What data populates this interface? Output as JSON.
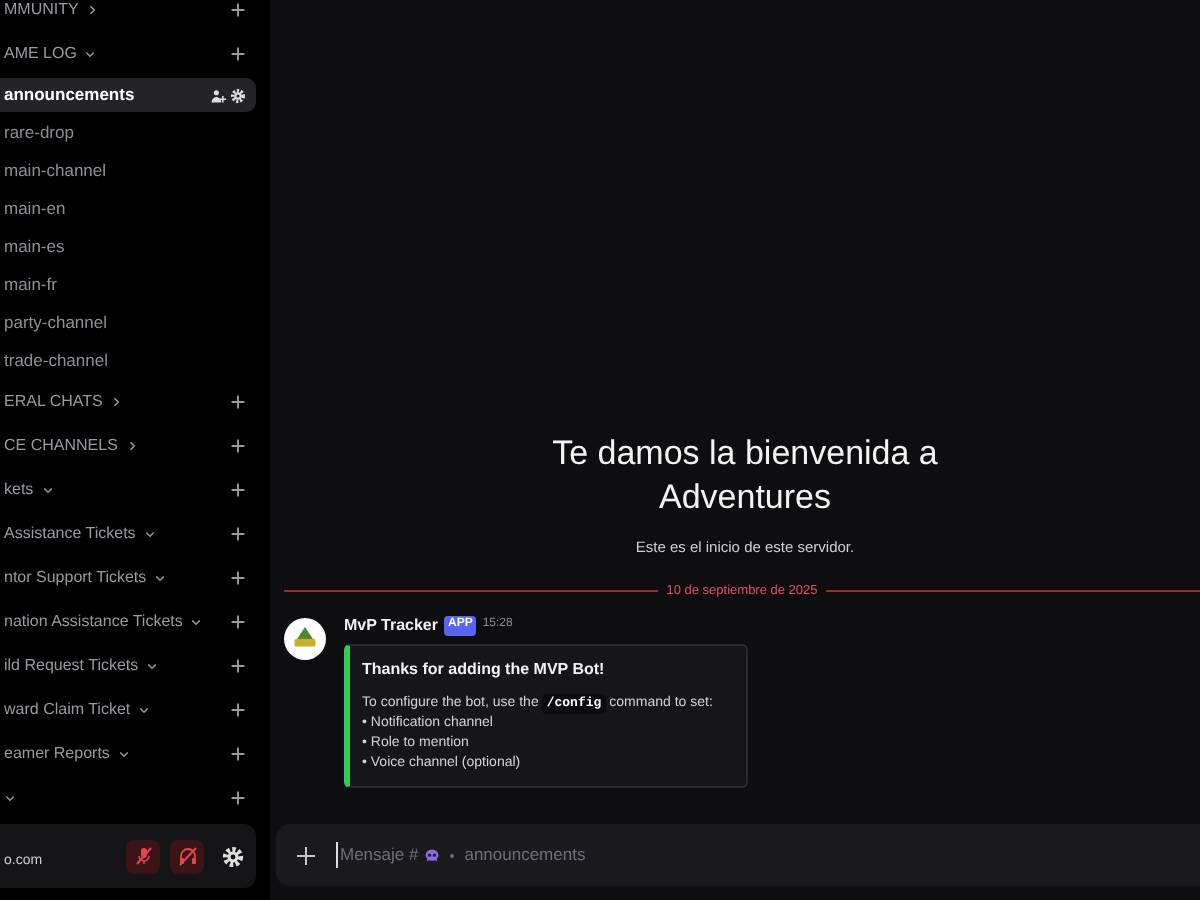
{
  "sidebar": {
    "sections": [
      {
        "kind": "category",
        "label": "MMUNITY",
        "expanded": false
      },
      {
        "kind": "category",
        "label": "AME LOG",
        "expanded": true
      },
      {
        "kind": "channel",
        "label": "announcements",
        "selected": true
      },
      {
        "kind": "channel",
        "label": "rare-drop",
        "selected": false
      },
      {
        "kind": "channel",
        "label": "main-channel",
        "selected": false
      },
      {
        "kind": "channel",
        "label": "main-en",
        "selected": false
      },
      {
        "kind": "channel",
        "label": "main-es",
        "selected": false
      },
      {
        "kind": "channel",
        "label": "main-fr",
        "selected": false
      },
      {
        "kind": "channel",
        "label": "party-channel",
        "selected": false
      },
      {
        "kind": "channel",
        "label": "trade-channel",
        "selected": false
      },
      {
        "kind": "category",
        "label": "ERAL CHATS",
        "expanded": false
      },
      {
        "kind": "category",
        "label": "CE CHANNELS",
        "expanded": false
      },
      {
        "kind": "category",
        "label": "kets",
        "expanded": true
      },
      {
        "kind": "category",
        "label": "Assistance Tickets",
        "expanded": true
      },
      {
        "kind": "category",
        "label": "ntor Support Tickets",
        "expanded": true
      },
      {
        "kind": "category",
        "label": "nation Assistance Tickets",
        "expanded": true
      },
      {
        "kind": "category",
        "label": "ild Request Tickets",
        "expanded": true
      },
      {
        "kind": "category",
        "label": "ward Claim Ticket",
        "expanded": true
      },
      {
        "kind": "category",
        "label": "eamer Reports",
        "expanded": true
      },
      {
        "kind": "category",
        "expanded": true
      }
    ],
    "user_panel": {
      "username": "o.com",
      "muted": true,
      "deafened": true
    }
  },
  "welcome": {
    "title": "Te damos la bienvenida a Adventures",
    "subtitle": "Este es el inicio de este servidor."
  },
  "date_divider": "10 de septiembre de 2025",
  "messages": [
    {
      "author": "MvP Tracker",
      "badge": "APP",
      "time": "15:28",
      "embed": {
        "title": "Thanks for adding the MVP Bot!",
        "intro_before": "To configure the bot, use the",
        "command": "/config",
        "intro_after": "command to set:",
        "bullets": [
          "• Notification channel",
          "• Role to mention",
          "• Voice channel (optional)"
        ]
      }
    }
  ],
  "composer": {
    "hint_prefix": "Mensaje #",
    "hint_channel": "announcements"
  }
}
